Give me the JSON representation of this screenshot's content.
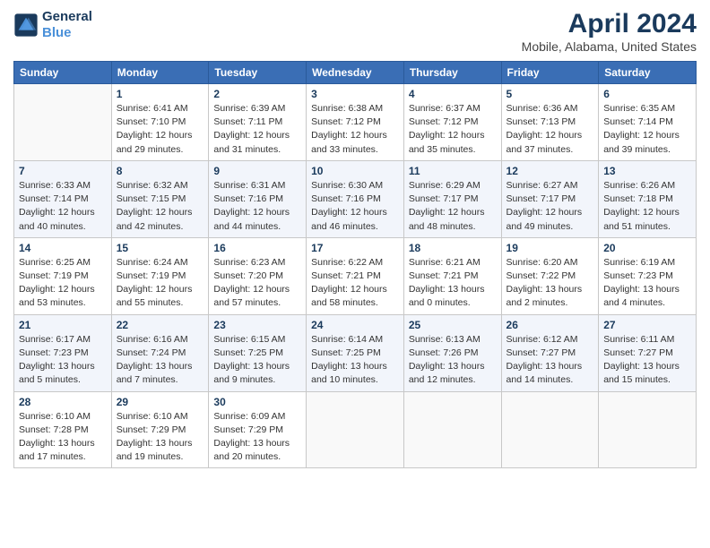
{
  "header": {
    "logo_line1": "General",
    "logo_line2": "Blue",
    "title": "April 2024",
    "subtitle": "Mobile, Alabama, United States"
  },
  "days_of_week": [
    "Sunday",
    "Monday",
    "Tuesday",
    "Wednesday",
    "Thursday",
    "Friday",
    "Saturday"
  ],
  "weeks": [
    [
      {
        "num": "",
        "info": ""
      },
      {
        "num": "1",
        "info": "Sunrise: 6:41 AM\nSunset: 7:10 PM\nDaylight: 12 hours\nand 29 minutes."
      },
      {
        "num": "2",
        "info": "Sunrise: 6:39 AM\nSunset: 7:11 PM\nDaylight: 12 hours\nand 31 minutes."
      },
      {
        "num": "3",
        "info": "Sunrise: 6:38 AM\nSunset: 7:12 PM\nDaylight: 12 hours\nand 33 minutes."
      },
      {
        "num": "4",
        "info": "Sunrise: 6:37 AM\nSunset: 7:12 PM\nDaylight: 12 hours\nand 35 minutes."
      },
      {
        "num": "5",
        "info": "Sunrise: 6:36 AM\nSunset: 7:13 PM\nDaylight: 12 hours\nand 37 minutes."
      },
      {
        "num": "6",
        "info": "Sunrise: 6:35 AM\nSunset: 7:14 PM\nDaylight: 12 hours\nand 39 minutes."
      }
    ],
    [
      {
        "num": "7",
        "info": "Sunrise: 6:33 AM\nSunset: 7:14 PM\nDaylight: 12 hours\nand 40 minutes."
      },
      {
        "num": "8",
        "info": "Sunrise: 6:32 AM\nSunset: 7:15 PM\nDaylight: 12 hours\nand 42 minutes."
      },
      {
        "num": "9",
        "info": "Sunrise: 6:31 AM\nSunset: 7:16 PM\nDaylight: 12 hours\nand 44 minutes."
      },
      {
        "num": "10",
        "info": "Sunrise: 6:30 AM\nSunset: 7:16 PM\nDaylight: 12 hours\nand 46 minutes."
      },
      {
        "num": "11",
        "info": "Sunrise: 6:29 AM\nSunset: 7:17 PM\nDaylight: 12 hours\nand 48 minutes."
      },
      {
        "num": "12",
        "info": "Sunrise: 6:27 AM\nSunset: 7:17 PM\nDaylight: 12 hours\nand 49 minutes."
      },
      {
        "num": "13",
        "info": "Sunrise: 6:26 AM\nSunset: 7:18 PM\nDaylight: 12 hours\nand 51 minutes."
      }
    ],
    [
      {
        "num": "14",
        "info": "Sunrise: 6:25 AM\nSunset: 7:19 PM\nDaylight: 12 hours\nand 53 minutes."
      },
      {
        "num": "15",
        "info": "Sunrise: 6:24 AM\nSunset: 7:19 PM\nDaylight: 12 hours\nand 55 minutes."
      },
      {
        "num": "16",
        "info": "Sunrise: 6:23 AM\nSunset: 7:20 PM\nDaylight: 12 hours\nand 57 minutes."
      },
      {
        "num": "17",
        "info": "Sunrise: 6:22 AM\nSunset: 7:21 PM\nDaylight: 12 hours\nand 58 minutes."
      },
      {
        "num": "18",
        "info": "Sunrise: 6:21 AM\nSunset: 7:21 PM\nDaylight: 13 hours\nand 0 minutes."
      },
      {
        "num": "19",
        "info": "Sunrise: 6:20 AM\nSunset: 7:22 PM\nDaylight: 13 hours\nand 2 minutes."
      },
      {
        "num": "20",
        "info": "Sunrise: 6:19 AM\nSunset: 7:23 PM\nDaylight: 13 hours\nand 4 minutes."
      }
    ],
    [
      {
        "num": "21",
        "info": "Sunrise: 6:17 AM\nSunset: 7:23 PM\nDaylight: 13 hours\nand 5 minutes."
      },
      {
        "num": "22",
        "info": "Sunrise: 6:16 AM\nSunset: 7:24 PM\nDaylight: 13 hours\nand 7 minutes."
      },
      {
        "num": "23",
        "info": "Sunrise: 6:15 AM\nSunset: 7:25 PM\nDaylight: 13 hours\nand 9 minutes."
      },
      {
        "num": "24",
        "info": "Sunrise: 6:14 AM\nSunset: 7:25 PM\nDaylight: 13 hours\nand 10 minutes."
      },
      {
        "num": "25",
        "info": "Sunrise: 6:13 AM\nSunset: 7:26 PM\nDaylight: 13 hours\nand 12 minutes."
      },
      {
        "num": "26",
        "info": "Sunrise: 6:12 AM\nSunset: 7:27 PM\nDaylight: 13 hours\nand 14 minutes."
      },
      {
        "num": "27",
        "info": "Sunrise: 6:11 AM\nSunset: 7:27 PM\nDaylight: 13 hours\nand 15 minutes."
      }
    ],
    [
      {
        "num": "28",
        "info": "Sunrise: 6:10 AM\nSunset: 7:28 PM\nDaylight: 13 hours\nand 17 minutes."
      },
      {
        "num": "29",
        "info": "Sunrise: 6:10 AM\nSunset: 7:29 PM\nDaylight: 13 hours\nand 19 minutes."
      },
      {
        "num": "30",
        "info": "Sunrise: 6:09 AM\nSunset: 7:29 PM\nDaylight: 13 hours\nand 20 minutes."
      },
      {
        "num": "",
        "info": ""
      },
      {
        "num": "",
        "info": ""
      },
      {
        "num": "",
        "info": ""
      },
      {
        "num": "",
        "info": ""
      }
    ]
  ]
}
